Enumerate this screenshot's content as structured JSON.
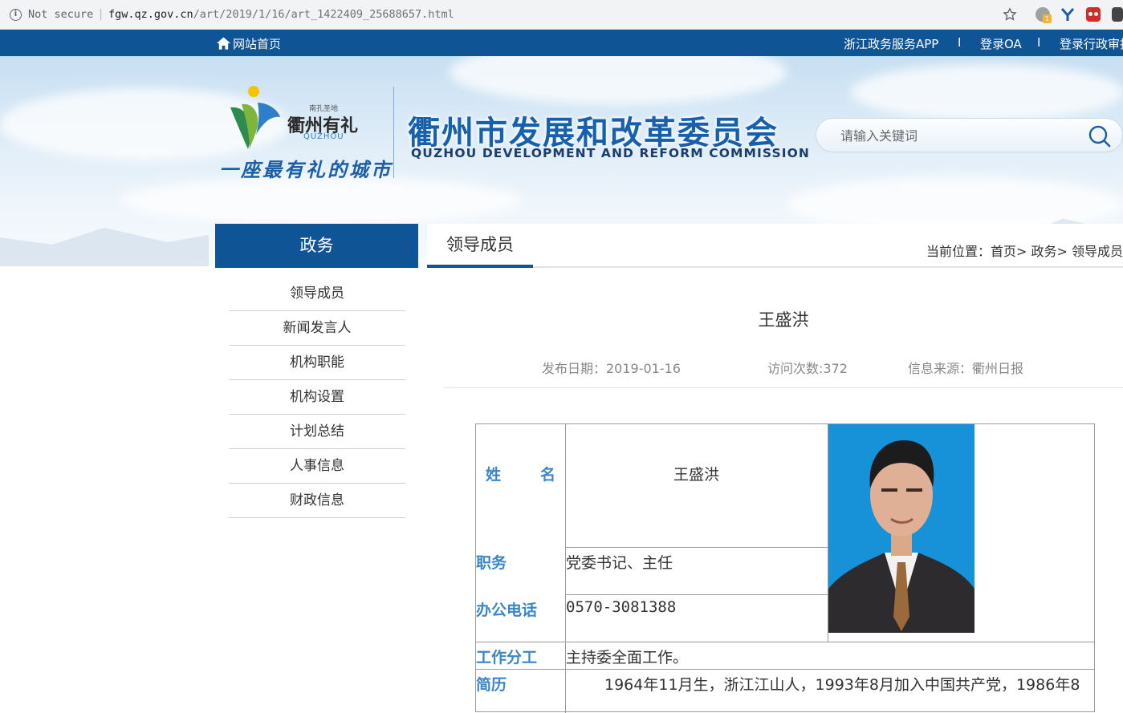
{
  "browser": {
    "security": "Not secure",
    "host": "fgw.qz.gov.cn",
    "path": "/art/2019/1/16/art_1422409_25688657.html",
    "ext_badge": "1"
  },
  "topnav": {
    "home": "网站首页",
    "app": "浙江政务服务APP",
    "divider": "I",
    "oa": "登录OA",
    "admin": "登录行政审批"
  },
  "logo": {
    "small": "南孔圣地",
    "name": "衢州有礼",
    "en": "QUZHOU",
    "slogan": "一座最有礼的城市"
  },
  "site": {
    "title": "衢州市发展和改革委员会",
    "title_en": "QUZHOU DEVELOPMENT AND REFORM COMMISSION"
  },
  "search": {
    "placeholder": "请输入关键词"
  },
  "sidebar": {
    "heading": "政务",
    "items": [
      "领导成员",
      "新闻发言人",
      "机构职能",
      "机构设置",
      "计划总结",
      "人事信息",
      "财政信息"
    ]
  },
  "content": {
    "tab": "领导成员",
    "breadcrumb": "当前位置：首页>  政务>  领导成员"
  },
  "article": {
    "title": "王盛洪",
    "date": "发布日期：2019-01-16",
    "visits": "访问次数:372",
    "source": "信息来源：衢州日报"
  },
  "profile": {
    "name_label_1": "姓",
    "name_label_2": "名",
    "name": "王盛洪",
    "post_label": "职务",
    "post": "党委书记、主任",
    "phone_label": "办公电话",
    "phone": "0570-3081388",
    "duty_label": "工作分工",
    "duty": "主持委全面工作。",
    "bio_label": "简历",
    "bio": "1964年11月生，浙江江山人，1993年8月加入中国共产党，1986年8"
  },
  "colors": {
    "nav_blue": "#0f5494",
    "label_blue": "#3a86c8",
    "photo_bg": "#1792d8"
  }
}
